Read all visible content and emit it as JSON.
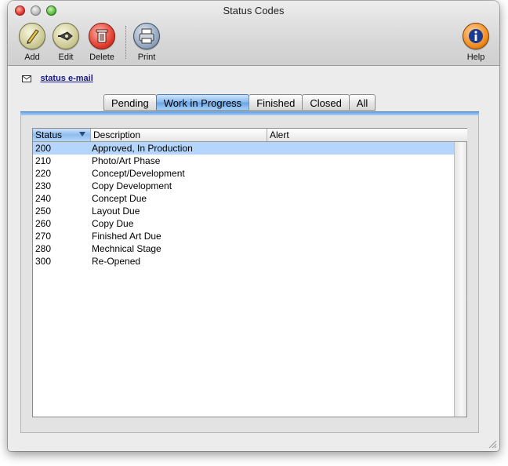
{
  "window": {
    "title": "Status Codes"
  },
  "toolbar": {
    "add": "Add",
    "edit": "Edit",
    "delete": "Delete",
    "print": "Print",
    "help": "Help"
  },
  "link": {
    "label": "status e-mail"
  },
  "tabs": [
    "Pending",
    "Work in Progress",
    "Finished",
    "Closed",
    "All"
  ],
  "active_tab": "Work in Progress",
  "table": {
    "columns": [
      "Status",
      "Description",
      "Alert"
    ],
    "rows": [
      [
        "200",
        "Approved, In Production"
      ],
      [
        "210",
        "Photo/Art Phase"
      ],
      [
        "220",
        "Concept/Development"
      ],
      [
        "230",
        "Copy Development"
      ],
      [
        "240",
        "Concept Due"
      ],
      [
        "250",
        "Layout Due"
      ],
      [
        "260",
        "Copy Due"
      ],
      [
        "270",
        "Finished Art Due"
      ],
      [
        "280",
        "Mechnical Stage"
      ],
      [
        "300",
        "Re-Opened"
      ]
    ],
    "selected_row": 0
  },
  "colors": {
    "accent": "#6aa6e6",
    "selection": "#b5d5fc"
  }
}
